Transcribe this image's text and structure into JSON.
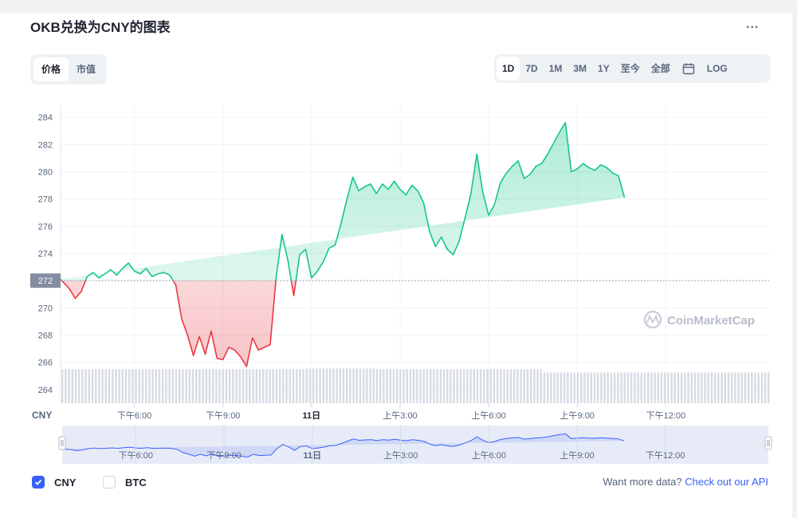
{
  "title": "OKB兑换为CNY的图表",
  "more_label": "...",
  "tabs": [
    {
      "label": "价格",
      "active": true
    },
    {
      "label": "市值",
      "active": false
    }
  ],
  "ranges": [
    {
      "label": "1D",
      "active": true
    },
    {
      "label": "7D",
      "active": false
    },
    {
      "label": "1M",
      "active": false
    },
    {
      "label": "3M",
      "active": false
    },
    {
      "label": "1Y",
      "active": false
    },
    {
      "label": "至今",
      "active": false
    },
    {
      "label": "全部",
      "active": false
    },
    {
      "label": "LOG",
      "active": false
    }
  ],
  "watermark": "CoinMarketCap",
  "legend": [
    {
      "label": "CNY",
      "checked": true
    },
    {
      "label": "BTC",
      "checked": false
    }
  ],
  "api": {
    "text": "Want more data?",
    "link": "Check out our API"
  },
  "colors": {
    "up": "#16c784",
    "down": "#ea3943",
    "accent": "#3861fb",
    "navigator": "#3861fb"
  },
  "chart_data": {
    "type": "line",
    "currency_label": "CNY",
    "baseline": 272,
    "ylim": [
      263,
      285
    ],
    "yticks": [
      264,
      266,
      268,
      270,
      272,
      274,
      276,
      278,
      280,
      282,
      284
    ],
    "xlim": [
      0,
      24
    ],
    "xticks": [
      {
        "x": 2.5,
        "label": "下午6:00"
      },
      {
        "x": 5.5,
        "label": "下午9:00"
      },
      {
        "x": 8.5,
        "label": "11日"
      },
      {
        "x": 11.5,
        "label": "上午3:00"
      },
      {
        "x": 14.5,
        "label": "上午6:00"
      },
      {
        "x": 17.5,
        "label": "上午9:00"
      },
      {
        "x": 20.5,
        "label": "下午12:00"
      }
    ],
    "x": [
      0,
      0.3,
      0.5,
      0.7,
      0.9,
      1.1,
      1.3,
      1.5,
      1.7,
      1.9,
      2.1,
      2.3,
      2.5,
      2.7,
      2.9,
      3.1,
      3.3,
      3.5,
      3.7,
      3.9,
      4.1,
      4.3,
      4.5,
      4.7,
      4.9,
      5.1,
      5.3,
      5.5,
      5.7,
      5.9,
      6.1,
      6.3,
      6.5,
      6.7,
      6.9,
      7.1,
      7.3,
      7.5,
      7.7,
      7.9,
      8.1,
      8.3,
      8.5,
      8.7,
      8.9,
      9.1,
      9.3,
      9.5,
      9.7,
      9.9,
      10.1,
      10.3,
      10.5,
      10.7,
      10.9,
      11.1,
      11.3,
      11.5,
      11.7,
      11.9,
      12.1,
      12.3,
      12.5,
      12.7,
      12.9,
      13.1,
      13.3,
      13.5,
      13.7,
      13.9,
      14.1,
      14.3,
      14.5,
      14.7,
      14.9,
      15.1,
      15.3,
      15.5,
      15.7,
      15.9,
      16.1,
      16.3,
      16.5,
      16.7,
      16.9,
      17.1,
      17.3,
      17.5,
      17.7,
      17.9,
      18.1,
      18.3,
      18.5,
      18.7,
      18.9,
      19.1,
      19.3,
      19.5,
      19.7,
      19.9,
      20.1,
      20.3,
      20.5,
      20.7,
      20.9,
      21.1,
      21.3,
      21.5,
      21.7,
      21.9,
      22.1,
      22.3,
      22.5,
      22.7,
      22.9,
      23.1,
      23.3,
      23.5,
      23.7,
      24
    ],
    "values": [
      272.1,
      271.4,
      270.7,
      271.2,
      272.3,
      272.6,
      272.2,
      272.5,
      272.8,
      272.4,
      272.9,
      273.3,
      272.7,
      272.5,
      272.9,
      272.3,
      272.5,
      272.6,
      272.4,
      271.7,
      269.2,
      268.0,
      266.5,
      267.9,
      266.6,
      268.3,
      266.3,
      266.2,
      267.1,
      266.9,
      266.4,
      265.7,
      267.8,
      266.9,
      267.1,
      267.3,
      272.2,
      275.4,
      273.5,
      270.9,
      273.9,
      274.3,
      272.2,
      272.7,
      273.4,
      274.4,
      274.6,
      276.2,
      278.0,
      279.6,
      278.6,
      278.9,
      279.1,
      278.4,
      279.1,
      278.7,
      279.3,
      278.7,
      278.3,
      279.0,
      278.6,
      277.7,
      275.6,
      274.5,
      275.2,
      274.3,
      273.9,
      274.9,
      276.6,
      278.4,
      281.3,
      278.5,
      276.8,
      277.6,
      279.2,
      279.9,
      280.4,
      280.8,
      279.5,
      279.8,
      280.4,
      280.6,
      281.3,
      282.1,
      282.9,
      283.6,
      280.0,
      280.2,
      280.6,
      280.3,
      280.1,
      280.5,
      280.3,
      279.9,
      279.7,
      278.1
    ],
    "volume_level": "constant"
  }
}
